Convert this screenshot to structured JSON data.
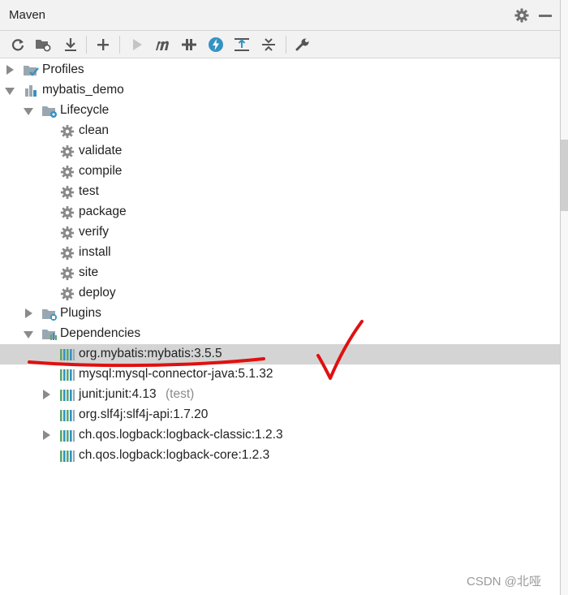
{
  "window": {
    "title": "Maven"
  },
  "colors": {
    "accent_blue": "#3592c4",
    "tree_green": "#59a869",
    "selection": "#d4d4d4",
    "annotation_red": "#e01010"
  },
  "toolbar": {
    "icons": [
      "reload-icon",
      "reimport-folder-icon",
      "download-icon",
      "add-icon",
      "run-icon",
      "maven-goal-icon",
      "toggle-offline-icon",
      "skip-tests-icon",
      "show-dependencies-icon",
      "collapse-all-icon",
      "settings-wrench-icon"
    ]
  },
  "tree": {
    "profiles": "Profiles",
    "project": "mybatis_demo",
    "lifecycle": "Lifecycle",
    "phases": [
      "clean",
      "validate",
      "compile",
      "test",
      "package",
      "verify",
      "install",
      "site",
      "deploy"
    ],
    "plugins": "Plugins",
    "dependencies": "Dependencies",
    "deps": [
      {
        "name": "org.mybatis:mybatis:3.5.5",
        "scope": ""
      },
      {
        "name": "mysql:mysql-connector-java:5.1.32",
        "scope": ""
      },
      {
        "name": "junit:junit:4.13",
        "scope": "(test)"
      },
      {
        "name": "org.slf4j:slf4j-api:1.7.20",
        "scope": ""
      },
      {
        "name": "ch.qos.logback:logback-classic:1.2.3",
        "scope": ""
      },
      {
        "name": "ch.qos.logback:logback-core:1.2.3",
        "scope": ""
      }
    ]
  },
  "watermark": "CSDN @北哑"
}
